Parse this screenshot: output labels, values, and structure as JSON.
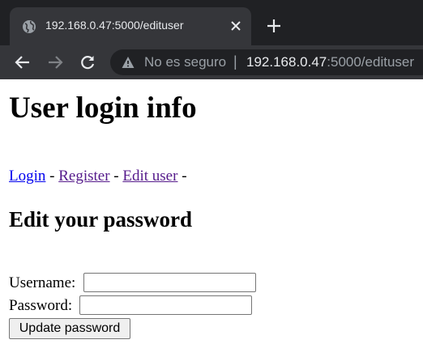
{
  "browser": {
    "tab": {
      "title": "192.168.0.47:5000/edituser",
      "favicon": "globe-icon"
    },
    "omnibox": {
      "security_label": "No es seguro",
      "separator": "|",
      "url_host": "192.168.0.47",
      "url_rest": ":5000/edituser"
    },
    "colors": {
      "tabstrip": "#202124",
      "toolbar": "#35363a",
      "omnibox": "#202124"
    }
  },
  "page": {
    "title": "User login info",
    "nav": {
      "links": [
        "Login",
        "Register",
        "Edit user"
      ],
      "separator": "-"
    },
    "section_title": "Edit your password",
    "form": {
      "username_label": "Username:",
      "username_value": "",
      "password_label": "Password:",
      "password_value": "",
      "submit_label": "Update password"
    },
    "colors": {
      "link": "#0000ee",
      "visited_link": "#551a8b"
    }
  }
}
